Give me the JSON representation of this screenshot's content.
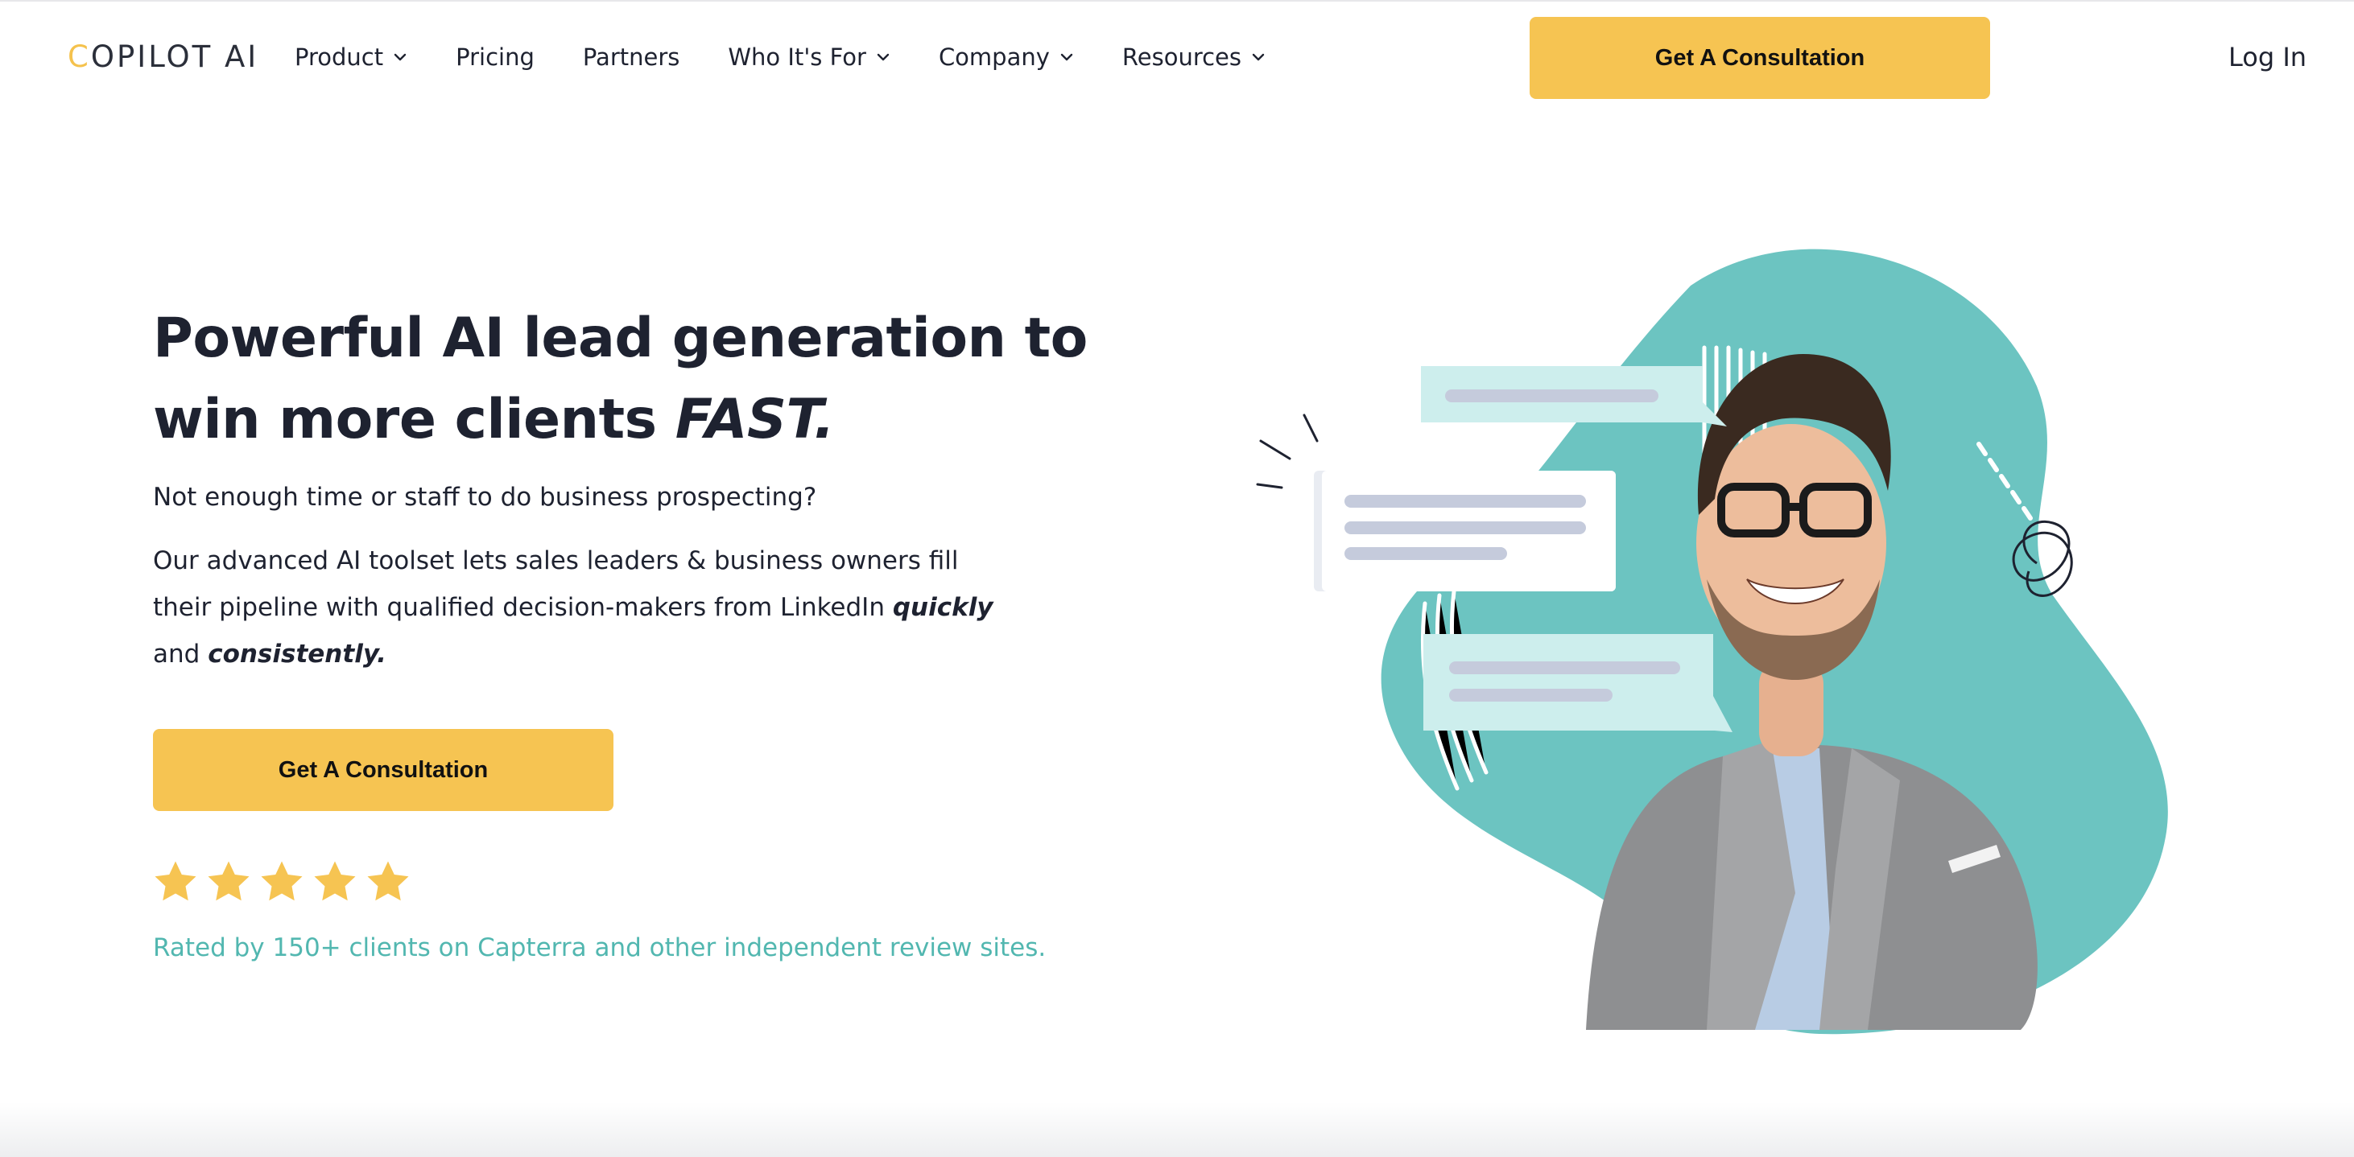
{
  "logo": {
    "first_letter": "C",
    "rest": "OPILOT AI"
  },
  "nav": {
    "items": [
      {
        "label": "Product",
        "has_dropdown": true
      },
      {
        "label": "Pricing",
        "has_dropdown": false
      },
      {
        "label": "Partners",
        "has_dropdown": false
      },
      {
        "label": "Who It's For",
        "has_dropdown": true
      },
      {
        "label": "Company",
        "has_dropdown": true
      },
      {
        "label": "Resources",
        "has_dropdown": true
      }
    ],
    "cta_label": "Get A Consultation",
    "login_label": "Log In"
  },
  "hero": {
    "title_line1": "Powerful AI lead generation to",
    "title_line2_plain": "win more clients ",
    "title_line2_emph": "FAST.",
    "subtitle": "Not enough time or staff to do business prospecting?",
    "description_part1": "Our advanced AI toolset lets sales leaders & business owners fill their pipeline with qualified decision-makers from LinkedIn ",
    "description_emph1": "quickly",
    "description_part2": " and ",
    "description_emph2": "consistently.",
    "cta_label": "Get A Consultation",
    "rating_stars": 5,
    "rating_text": "Rated by 150+ clients on Capterra and other independent review sites."
  },
  "colors": {
    "accent_yellow": "#f6c452",
    "teal_blob": "#6cc4c1",
    "rating_teal": "#52b7b0",
    "text_dark": "#1e2230"
  },
  "icons": {
    "dropdown": "chevron-down-icon",
    "star": "star-icon"
  }
}
